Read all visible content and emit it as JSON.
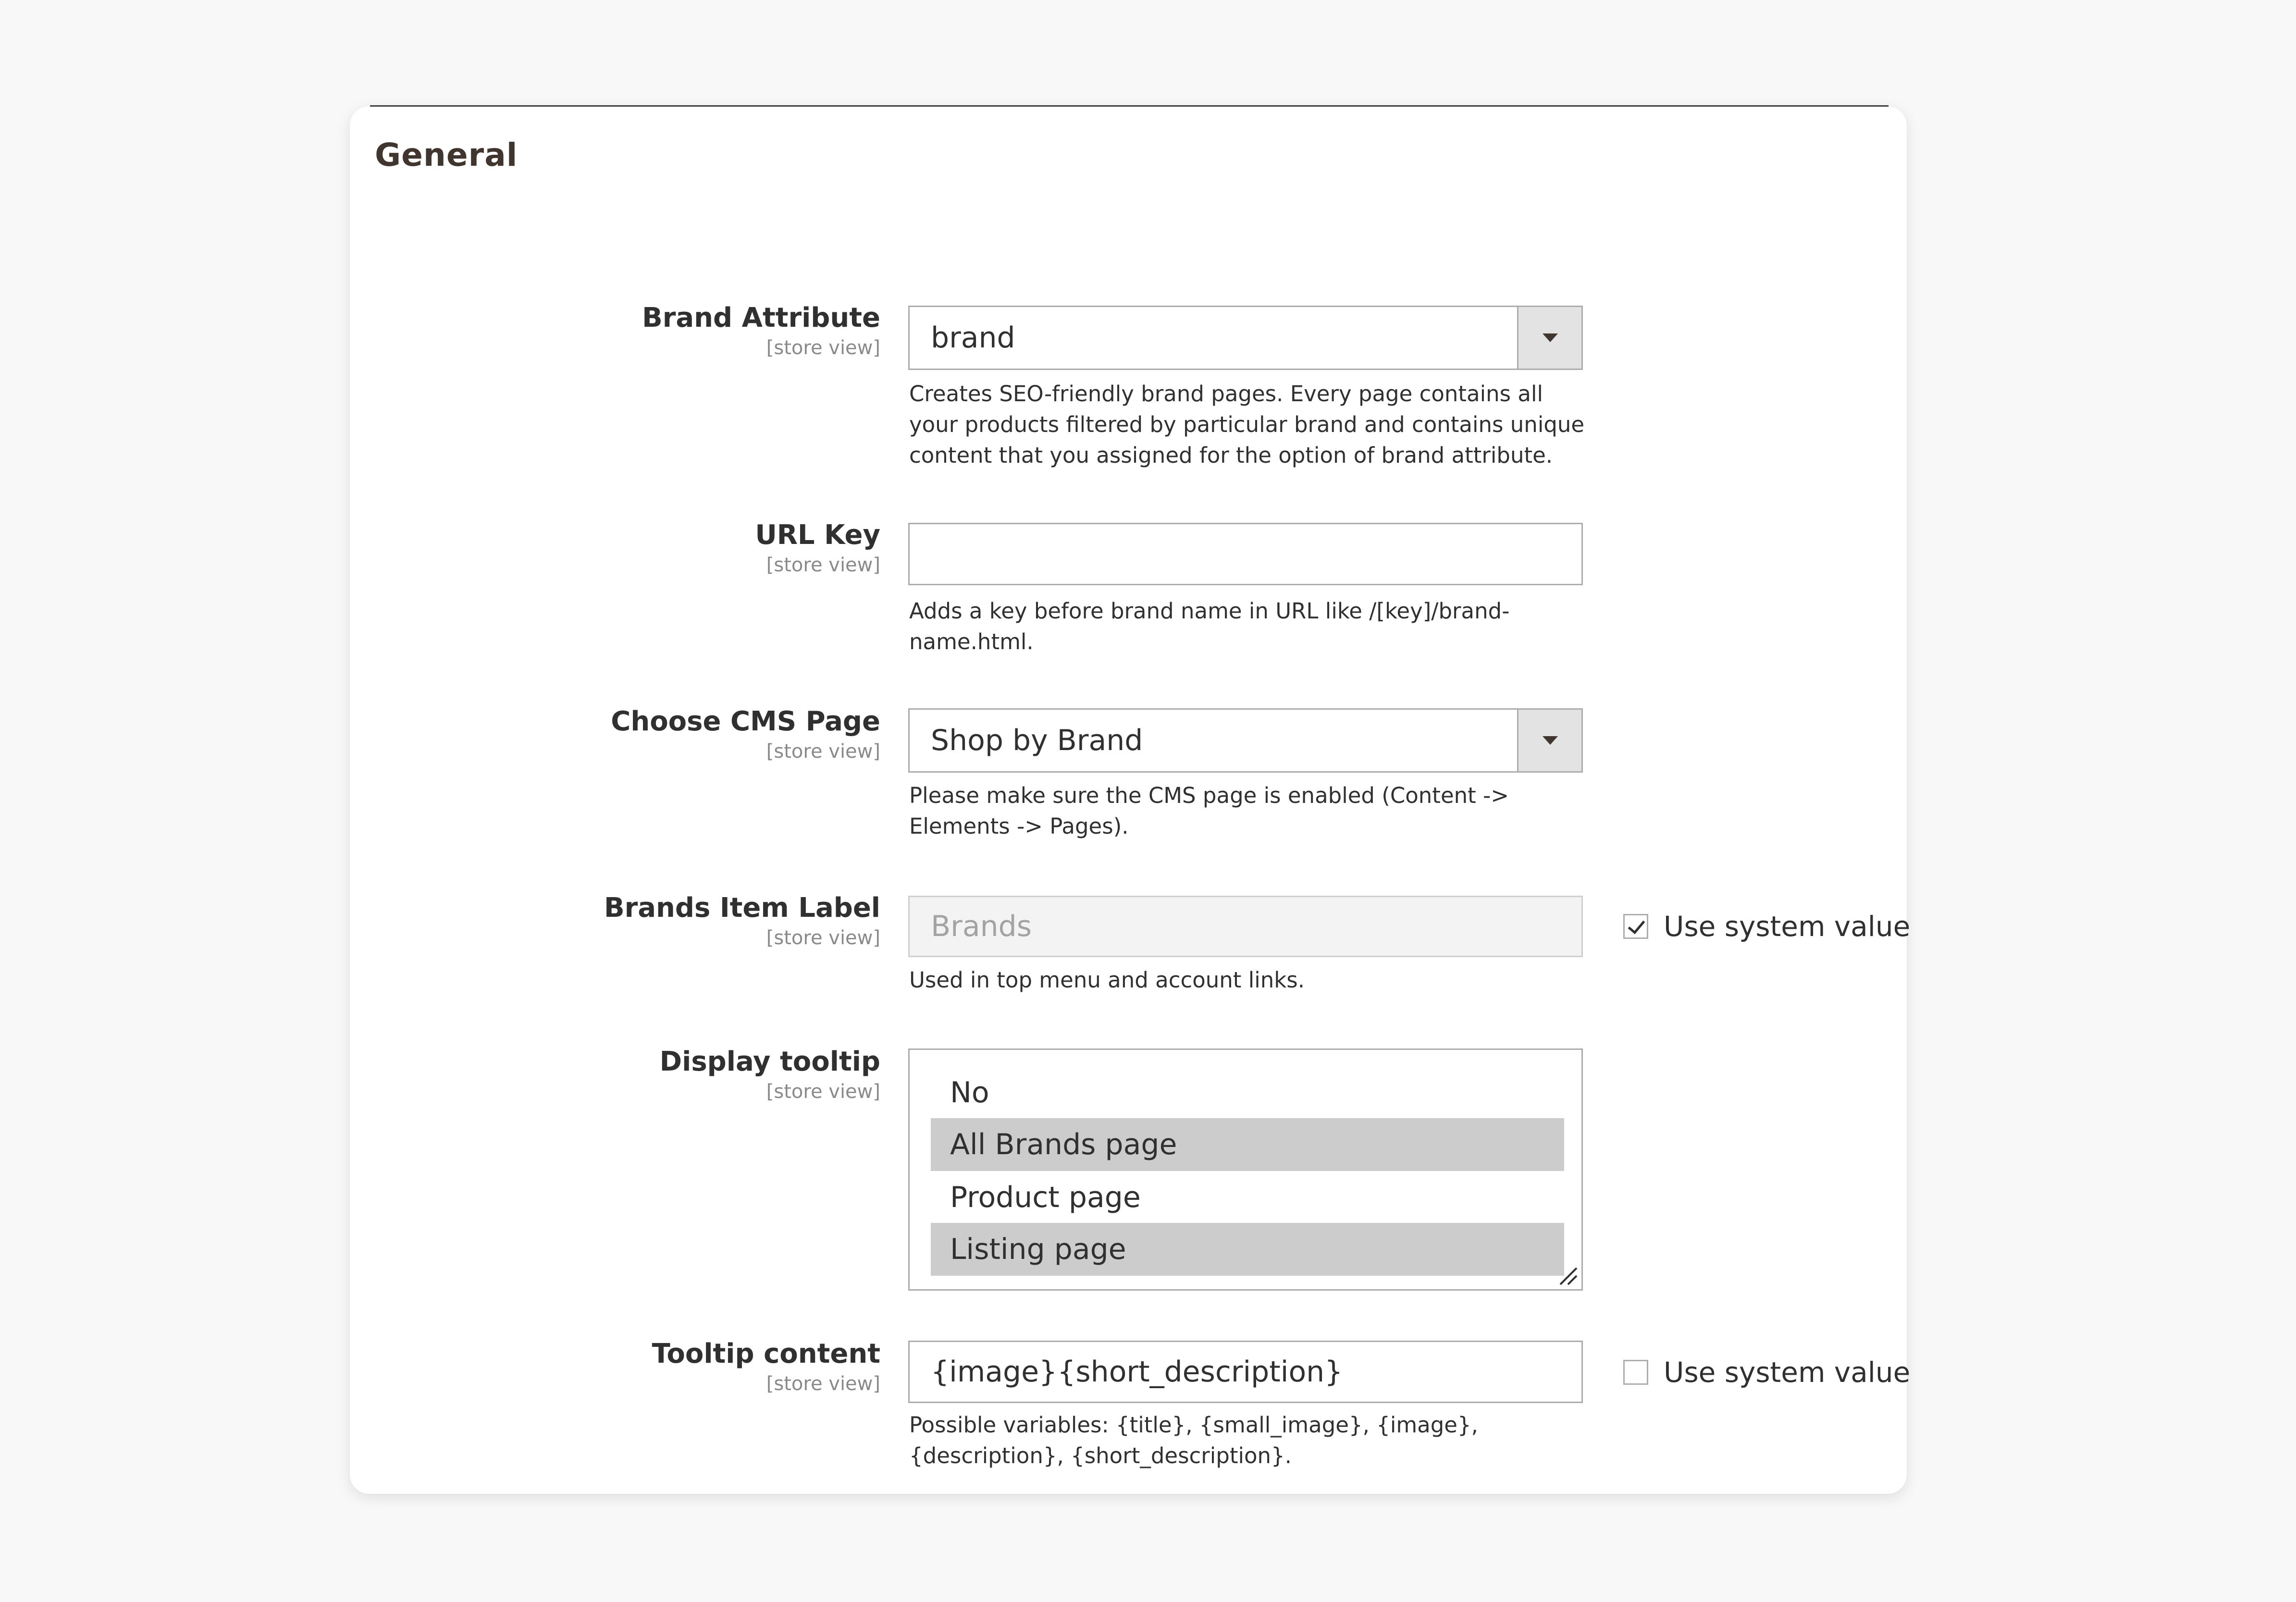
{
  "section": {
    "title": "General"
  },
  "scope_label": "[store view]",
  "fields": {
    "brand_attribute": {
      "label": "Brand Attribute",
      "value": "brand",
      "note": "Creates SEO-friendly brand pages. Every page contains all your products filtered by particular brand and contains unique content that you assigned for the option of brand attribute."
    },
    "url_key": {
      "label": "URL Key",
      "value": "",
      "note": "Adds a key before brand name in URL like /[key]/brand-name.html."
    },
    "cms_page": {
      "label": "Choose CMS Page",
      "value": "Shop by Brand",
      "note": "Please make sure the CMS page is enabled (Content -> Elements -> Pages)."
    },
    "brands_item_label": {
      "label": "Brands Item Label",
      "value": "Brands",
      "note": "Used in top menu and account links.",
      "use_system_value_label": "Use system value",
      "use_system_value_checked": true
    },
    "display_tooltip": {
      "label": "Display tooltip",
      "options": [
        {
          "label": "No",
          "selected": false
        },
        {
          "label": "All Brands page",
          "selected": true
        },
        {
          "label": "Product page",
          "selected": false
        },
        {
          "label": "Listing page",
          "selected": true
        }
      ]
    },
    "tooltip_content": {
      "label": "Tooltip content",
      "value": "{image}{short_description}",
      "note": "Possible variables: {title}, {small_image}, {image}, {description}, {short_description}.",
      "use_system_value_label": "Use system value",
      "use_system_value_checked": false
    }
  },
  "colors": {
    "page_bg": "#f8f8f8",
    "panel_bg": "#ffffff",
    "border": "#adadad",
    "selected_option_bg": "#cccccc",
    "text": "#303030",
    "scope_text": "#8a8a8a"
  }
}
